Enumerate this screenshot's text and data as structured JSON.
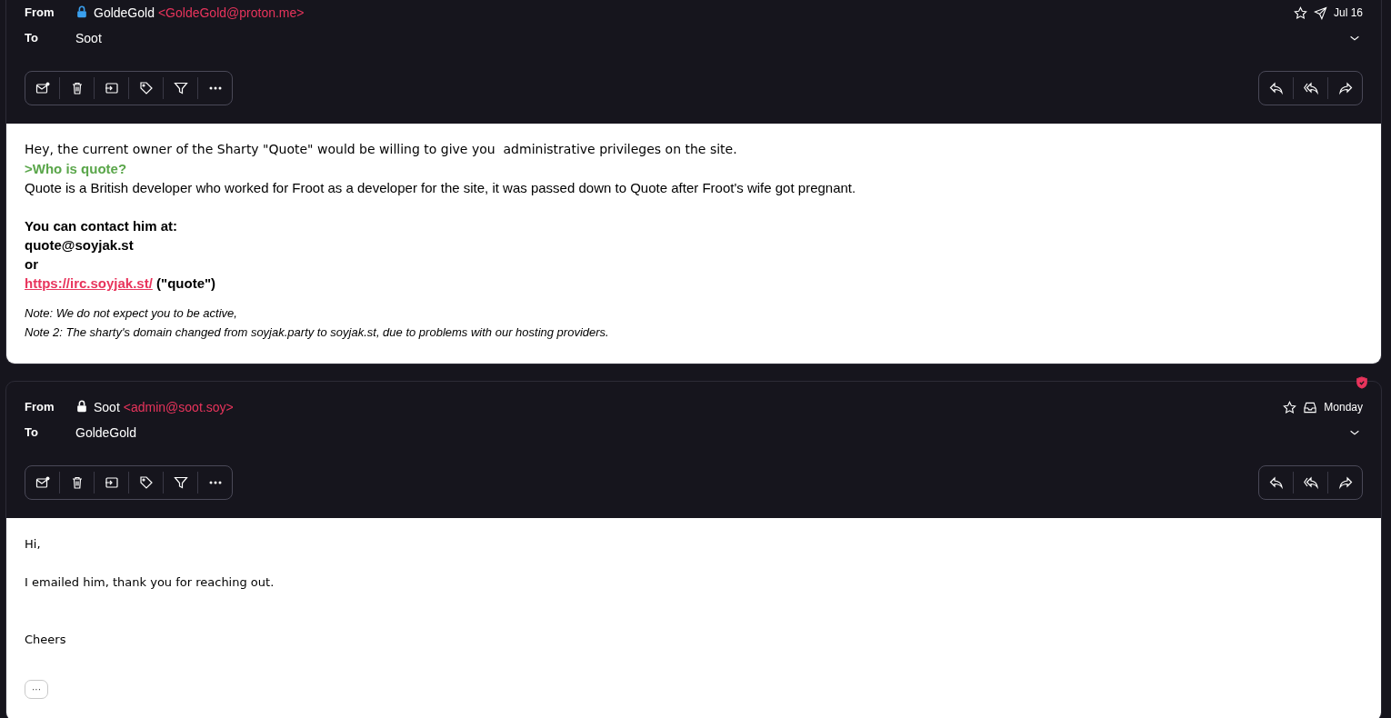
{
  "messages": [
    {
      "from_label": "From",
      "sender_name": "GoldeGold",
      "sender_address": "<GoldeGold@proton.me>",
      "encrypted": true,
      "to_label": "To",
      "recipient": "Soot",
      "sent": true,
      "date": "Jul 16",
      "starred": false,
      "body": [
        {
          "kind": "serif-plain",
          "text": "Hey, the current owner of the Sharty \"Quote\" would be willing to give you  administrative privileges on the site."
        },
        {
          "kind": "quote",
          "text": ">Who is quote?"
        },
        {
          "kind": "plain",
          "text": "Quote is a British developer who worked for Froot as a developer for the site, it was passed down to Quote after Froot's wife got pregnant."
        },
        {
          "kind": "blank"
        },
        {
          "kind": "bold",
          "text": "You can contact him at:"
        },
        {
          "kind": "bold",
          "text": "quote@soyjak.st"
        },
        {
          "kind": "bold",
          "text": "or"
        },
        {
          "kind": "link",
          "link": "https://irc.soyjak.st/",
          "text": " (\"quote\")"
        },
        {
          "kind": "blank-small"
        },
        {
          "kind": "note",
          "text": "Note: We do not expect you to be active,"
        },
        {
          "kind": "note",
          "text": "Note 2: The sharty's domain changed from soyjak.party to soyjak.st, due to problems with our hosting providers."
        }
      ]
    },
    {
      "from_label": "From",
      "sender_name": "Soot",
      "sender_address": "<admin@soot.soy>",
      "encrypted": false,
      "to_label": "To",
      "recipient": "GoldeGold",
      "sent": false,
      "date": "Monday",
      "starred": false,
      "verified": true,
      "body": [
        {
          "kind": "small",
          "text": "Hi,"
        },
        {
          "kind": "blank"
        },
        {
          "kind": "small",
          "text": "I emailed him, thank you for reaching out."
        },
        {
          "kind": "blank"
        },
        {
          "kind": "blank"
        },
        {
          "kind": "small",
          "text": "Cheers"
        }
      ],
      "show_more_label": "···"
    }
  ]
}
